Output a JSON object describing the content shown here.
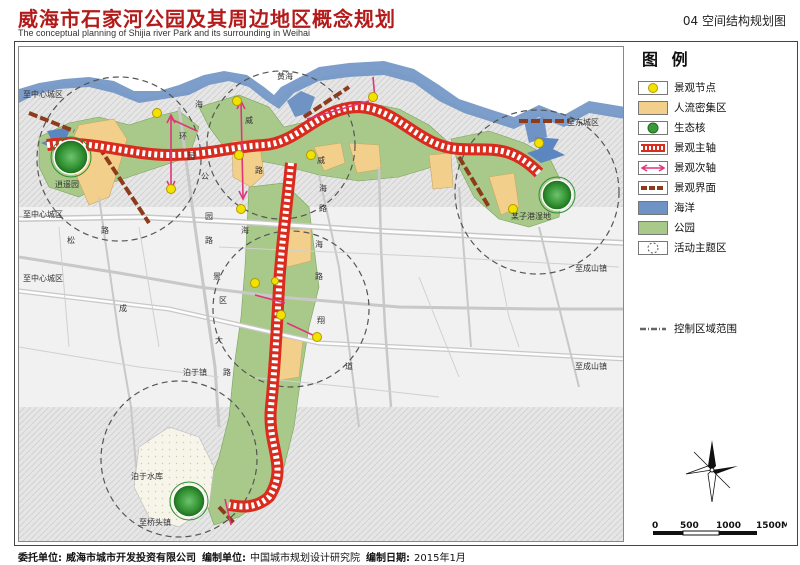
{
  "header": {
    "title_cn": "威海市石家河公园及其周边地区概念规划",
    "title_en": "The conceptual planning of Shijia river Park  and its surrounding in  Weihai",
    "sheet": "04  空间结构规划图"
  },
  "legend": {
    "title": "图 例",
    "items": [
      {
        "label": "景观节点",
        "icon": "landscape-node-icon"
      },
      {
        "label": "人流密集区",
        "icon": "crowd-area-icon"
      },
      {
        "label": "生态核",
        "icon": "ecological-core-icon"
      },
      {
        "label": "景观主轴",
        "icon": "main-axis-icon"
      },
      {
        "label": "景观次轴",
        "icon": "secondary-axis-icon"
      },
      {
        "label": "景观界面",
        "icon": "landscape-interface-icon"
      },
      {
        "label": "海洋",
        "icon": "ocean-icon"
      },
      {
        "label": "公园",
        "icon": "park-icon"
      },
      {
        "label": "活动主题区",
        "icon": "activity-zone-icon"
      }
    ],
    "extra": {
      "label": "控制区域范围",
      "icon": "control-boundary-icon"
    }
  },
  "scale_bar": {
    "ticks": [
      "0",
      "500",
      "1000",
      "1500M"
    ]
  },
  "colors": {
    "title": "#b31b1b",
    "park": "#a8c98a",
    "crowd": "#f2cf8a",
    "ocean": "#6f93c4",
    "axis": "#d92b1e",
    "interface": "#8e3b1c",
    "node": "#f2e200",
    "core": "#3a9a3a"
  },
  "map_labels": {
    "huanghai": "黄海",
    "xiaoyaoyuan": "逍遥园",
    "zhi_zhongxin_w": "至中心城区",
    "zhi_zhongxin_w2": "至中心城区",
    "zhi_zhongxin_w3": "至中心城区",
    "zhi_dongcheng": "至东城区",
    "zhi_chengshan_1": "至成山镇",
    "zhi_chengshan_2": "至成山镇",
    "wetland": "某子港湿地",
    "bozhen": "泊于镇",
    "reservoir": "泊于水库",
    "zhi_qiaotou": "至桥头镇",
    "road_huan": "环",
    "road_hai": "海",
    "road_lu": "路",
    "road_gong": "公",
    "road_yuan": "园",
    "road_wei": "威",
    "road_cheng": "成",
    "road_da": "大",
    "road_dao": "道",
    "road_jing": "景",
    "road_qu": "区",
    "road_hai2": "海",
    "road_lu2": "路",
    "road_xiang": "翔",
    "road_wei2": "威",
    "road_lu3": "路",
    "road_song": "松",
    "road_lu4": "路",
    "road_hai3": "海",
    "road_lu5": "路",
    "road_lu6": "路",
    "road_yuan2": "园",
    "road_hai4": "海"
  },
  "footer": {
    "client_label": "委托单位:",
    "client": "威海市城市开发投资有限公司",
    "designer_label": "编制单位:",
    "designer": "中国城市规划设计研究院",
    "date_label": "编制日期:",
    "date": "2015年1月"
  }
}
